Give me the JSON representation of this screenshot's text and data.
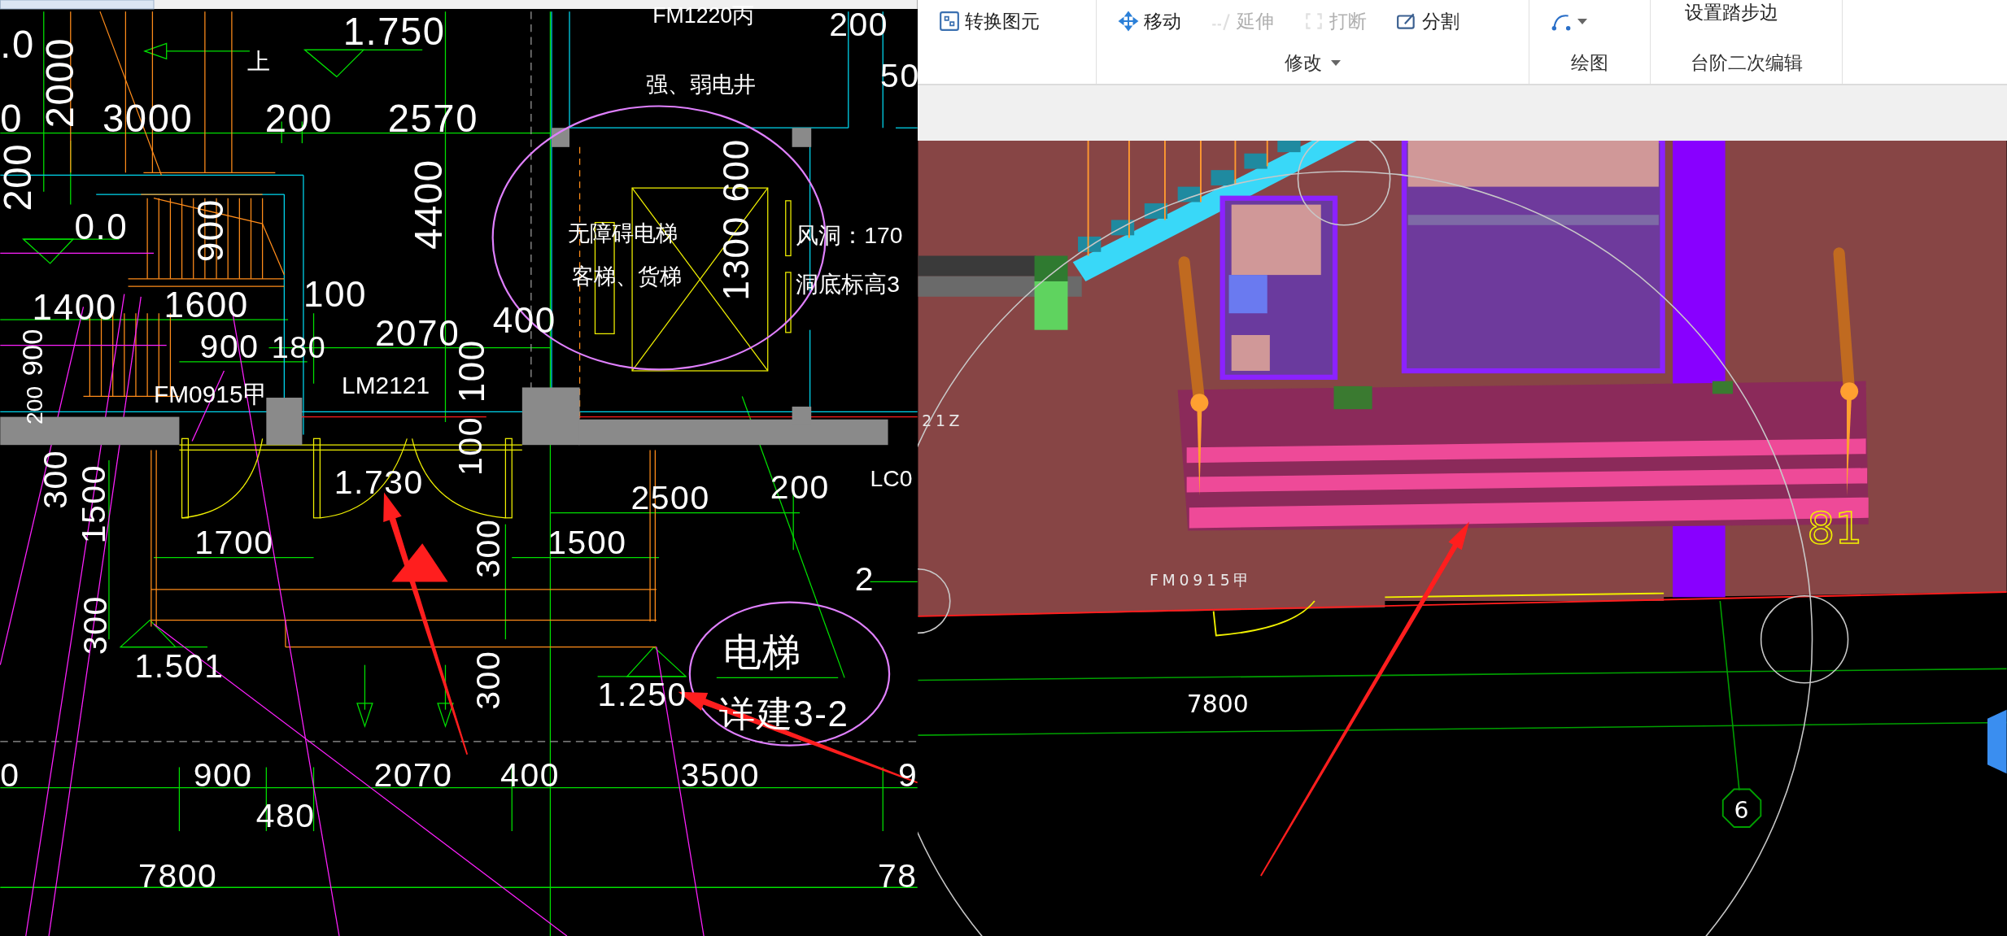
{
  "cad_plan": {
    "labels": [
      "FM1220丙",
      "1.750",
      "上",
      "200",
      "50",
      ".0",
      "2000",
      "0",
      "3000",
      "200",
      "2570",
      "强、弱电井",
      "200",
      "4400",
      "0.0",
      "900",
      "600",
      "无障碍电梯",
      "风洞：170",
      "1400",
      "1600",
      "100",
      "客梯、货梯",
      "1300",
      "洞底标高3",
      "2070",
      "400",
      "900",
      "900",
      "180",
      "FM0915甲",
      "LM2121",
      "100",
      "200",
      "300",
      "1500",
      "1.730",
      "100",
      "2500",
      "200",
      "LC0",
      "1700",
      "300",
      "1500",
      "2",
      "300",
      "1.501",
      "电梯",
      "详建3-2",
      "1.250",
      "300",
      "0",
      "900",
      "2070",
      "400",
      "3500",
      "9",
      "480",
      "7800",
      "78"
    ]
  },
  "toolbar": {
    "groups": [
      {
        "buttons": [
          {
            "label": "转换图元",
            "disabled": false
          }
        ]
      },
      {
        "label": "修改",
        "buttons": [
          {
            "label": "移动",
            "disabled": false
          },
          {
            "label": "延伸",
            "disabled": true
          },
          {
            "label": "打断",
            "disabled": true
          },
          {
            "label": "分割",
            "disabled": false
          }
        ]
      },
      {
        "label": "绘图",
        "buttons": [
          {
            "disabled": false
          }
        ]
      },
      {
        "label": "台阶二次编辑",
        "buttons": [
          {
            "label": "设置踏步边",
            "disabled": false
          }
        ]
      }
    ]
  },
  "view_3d": {
    "labels": [
      "21Z",
      "FM0915甲",
      "81",
      "7800",
      "6"
    ]
  }
}
